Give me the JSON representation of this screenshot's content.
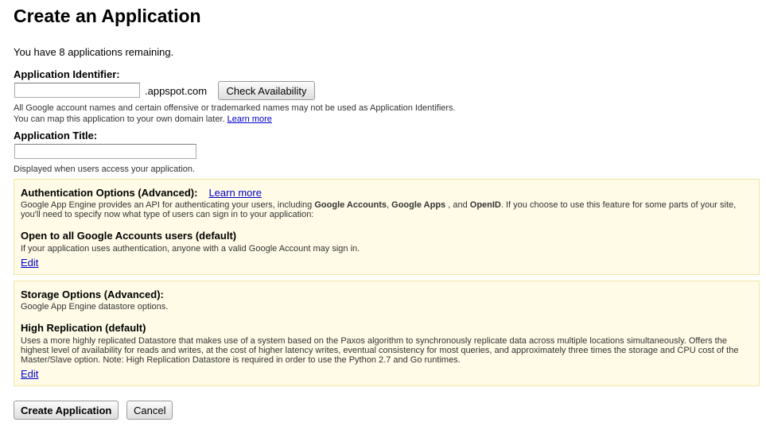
{
  "page": {
    "title": "Create an Application",
    "remaining_text": "You have 8 applications remaining."
  },
  "identifier": {
    "label": "Application Identifier:",
    "value": "",
    "suffix": ".appspot.com",
    "check_button": "Check Availability",
    "hint_line1": "All Google account names and certain offensive or trademarked names may not be used as Application Identifiers.",
    "hint_line2": "You can map this application to your own domain later.",
    "hint_link": "Learn more"
  },
  "title_field": {
    "label": "Application Title:",
    "value": "",
    "hint": "Displayed when users access your application."
  },
  "auth": {
    "heading": "Authentication Options (Advanced):",
    "learn_more": "Learn more",
    "desc_part1": "Google App Engine provides an API for authenticating your users, including ",
    "desc_bold1": "Google Accounts",
    "desc_sep1": ", ",
    "desc_bold2": "Google Apps",
    "desc_sep2": " , and ",
    "desc_bold3": "OpenID",
    "desc_part2": ". If you choose to use this feature for some parts of your site, you'll need to specify now what type of users can sign in to your application:",
    "option_title": "Open to all Google Accounts users (default)",
    "option_desc": "If your application uses authentication, anyone with a valid Google Account may sign in.",
    "edit": "Edit"
  },
  "storage": {
    "heading": "Storage Options (Advanced):",
    "desc": "Google App Engine datastore options.",
    "option_title": "High Replication (default)",
    "option_desc": "Uses a more highly replicated Datastore that makes use of a system based on the Paxos algorithm to synchronously replicate data across multiple locations simultaneously. Offers the highest level of availability for reads and writes, at the cost of higher latency writes, eventual consistency for most queries, and approximately three times the storage and CPU cost of the Master/Slave option. Note: High Replication Datastore is required in order to use the Python 2.7 and Go runtimes.",
    "edit": "Edit"
  },
  "actions": {
    "create": "Create Application",
    "cancel": "Cancel"
  },
  "colors": {
    "panel_bg": "#fffbe6",
    "panel_border": "#f2e6a7",
    "link": "#0000cc"
  }
}
